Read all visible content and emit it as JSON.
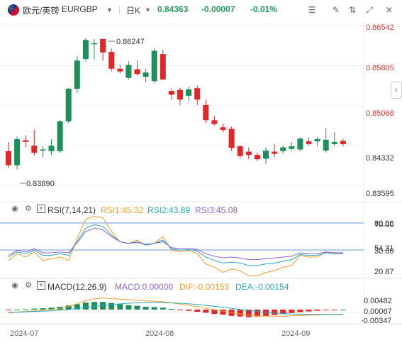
{
  "header": {
    "pair_name": "欧元/英镑",
    "symbol": "EURGBP",
    "interval": "日K",
    "last_price": "0.84363",
    "change": "-0.00007",
    "change_pct": "-0.01%"
  },
  "toolbar": {
    "pencil": "pencil-icon",
    "fullscreen": "fullscreen-icon",
    "close": "close-icon"
  },
  "price_axis": [
    "0.86542",
    "0.85805",
    "0.85068",
    "0.84332",
    "0.83595"
  ],
  "annotations": {
    "high": "0.86247",
    "low": "0.83890"
  },
  "rsi": {
    "title": "RSI(7,14,21)",
    "rsi1": "RSI1:45.32",
    "rsi2": "RSI2:43.89",
    "rsi3": "RSI3:45.08",
    "axis": [
      "80.06",
      "70.00",
      "54.31",
      "30.00",
      "20.87"
    ]
  },
  "macd": {
    "title": "MACD(12,26,9)",
    "macd": "MACD:0.00000",
    "dif": "DIF:-0.00153",
    "dea": "DEA:-0.00154",
    "axis": [
      "0.00482",
      "0.00067",
      "-0.00347"
    ]
  },
  "time_axis": [
    "2024-07",
    "2024-08",
    "2024-09"
  ],
  "colors": {
    "up": "#1e8e5a",
    "down": "#e02626",
    "price_red": "#d23c3c",
    "green_text": "#1e9e5a",
    "rsi1": "#f39c2b",
    "rsi2": "#2aa8b8",
    "rsi3": "#8a63d2",
    "dif": "#f39c2b",
    "dea": "#2aa8b8",
    "ref_line": "#3a78d6"
  },
  "chart_data": [
    {
      "type": "candlestick",
      "title": "",
      "ylim": [
        0.8335,
        0.8665
      ],
      "series": [
        {
          "name": "EURGBP",
          "candles": [
            {
              "o": 0.8423,
              "h": 0.844,
              "l": 0.8392,
              "c": 0.8397
            },
            {
              "o": 0.8397,
              "h": 0.845,
              "l": 0.8389,
              "c": 0.8445
            },
            {
              "o": 0.8443,
              "h": 0.8452,
              "l": 0.843,
              "c": 0.844
            },
            {
              "o": 0.8433,
              "h": 0.8462,
              "l": 0.8415,
              "c": 0.842
            },
            {
              "o": 0.8425,
              "h": 0.8432,
              "l": 0.8412,
              "c": 0.8426
            },
            {
              "o": 0.8423,
              "h": 0.8445,
              "l": 0.8416,
              "c": 0.8433
            },
            {
              "o": 0.8423,
              "h": 0.848,
              "l": 0.842,
              "c": 0.8478
            },
            {
              "o": 0.8478,
              "h": 0.854,
              "l": 0.8475,
              "c": 0.8538
            },
            {
              "o": 0.8538,
              "h": 0.8598,
              "l": 0.853,
              "c": 0.859
            },
            {
              "o": 0.8593,
              "h": 0.8631,
              "l": 0.8588,
              "c": 0.8628
            },
            {
              "o": 0.8622,
              "h": 0.863,
              "l": 0.8592,
              "c": 0.8622
            },
            {
              "o": 0.863,
              "h": 0.8624,
              "l": 0.859,
              "c": 0.8605
            },
            {
              "o": 0.8606,
              "h": 0.8612,
              "l": 0.857,
              "c": 0.8575
            },
            {
              "o": 0.8575,
              "h": 0.8582,
              "l": 0.8566,
              "c": 0.857
            },
            {
              "o": 0.8558,
              "h": 0.8589,
              "l": 0.8555,
              "c": 0.8582
            },
            {
              "o": 0.8574,
              "h": 0.859,
              "l": 0.8563,
              "c": 0.8565
            },
            {
              "o": 0.856,
              "h": 0.8575,
              "l": 0.855,
              "c": 0.8568
            },
            {
              "o": 0.8552,
              "h": 0.8612,
              "l": 0.8548,
              "c": 0.8608
            },
            {
              "o": 0.8602,
              "h": 0.861,
              "l": 0.8554,
              "c": 0.8555
            },
            {
              "o": 0.8534,
              "h": 0.8538,
              "l": 0.8518,
              "c": 0.8527
            },
            {
              "o": 0.8536,
              "h": 0.854,
              "l": 0.8508,
              "c": 0.8518
            },
            {
              "o": 0.8525,
              "h": 0.8542,
              "l": 0.8515,
              "c": 0.8537
            },
            {
              "o": 0.8539,
              "h": 0.8544,
              "l": 0.8508,
              "c": 0.8518
            },
            {
              "o": 0.8508,
              "h": 0.8518,
              "l": 0.8475,
              "c": 0.848
            },
            {
              "o": 0.848,
              "h": 0.8488,
              "l": 0.847,
              "c": 0.8473
            },
            {
              "o": 0.8467,
              "h": 0.8473,
              "l": 0.8458,
              "c": 0.8462
            },
            {
              "o": 0.8464,
              "h": 0.8468,
              "l": 0.8424,
              "c": 0.8429
            },
            {
              "o": 0.8432,
              "h": 0.8434,
              "l": 0.841,
              "c": 0.8414
            },
            {
              "o": 0.8422,
              "h": 0.843,
              "l": 0.8408,
              "c": 0.8416
            },
            {
              "o": 0.8416,
              "h": 0.842,
              "l": 0.8405,
              "c": 0.8408
            },
            {
              "o": 0.8409,
              "h": 0.843,
              "l": 0.84,
              "c": 0.8424
            },
            {
              "o": 0.8422,
              "h": 0.8436,
              "l": 0.8412,
              "c": 0.8418
            },
            {
              "o": 0.8423,
              "h": 0.8434,
              "l": 0.8418,
              "c": 0.843
            },
            {
              "o": 0.8427,
              "h": 0.844,
              "l": 0.8424,
              "c": 0.8432
            },
            {
              "o": 0.8426,
              "h": 0.8448,
              "l": 0.8423,
              "c": 0.8446
            },
            {
              "o": 0.8441,
              "h": 0.8448,
              "l": 0.8434,
              "c": 0.8436
            },
            {
              "o": 0.8441,
              "h": 0.8449,
              "l": 0.8432,
              "c": 0.8445
            },
            {
              "o": 0.8424,
              "h": 0.8465,
              "l": 0.842,
              "c": 0.8444
            },
            {
              "o": 0.8436,
              "h": 0.8458,
              "l": 0.8432,
              "c": 0.844
            },
            {
              "o": 0.8442,
              "h": 0.8446,
              "l": 0.8432,
              "c": 0.8436
            }
          ]
        }
      ]
    },
    {
      "type": "line",
      "title": "RSI(7,14,21)",
      "ylim": [
        15,
        90
      ],
      "series": [
        {
          "name": "RSI1",
          "values": [
            36,
            44,
            40,
            46,
            36,
            38,
            40,
            36,
            62,
            84,
            88,
            86,
            70,
            58,
            56,
            60,
            54,
            56,
            64,
            48,
            46,
            48,
            44,
            32,
            28,
            22,
            26,
            24,
            18,
            18,
            22,
            24,
            28,
            30,
            42,
            40,
            40,
            46,
            44,
            45.3
          ]
        },
        {
          "name": "RSI2",
          "values": [
            40,
            46,
            44,
            48,
            42,
            42,
            44,
            42,
            58,
            74,
            78,
            76,
            66,
            58,
            56,
            58,
            54,
            56,
            60,
            50,
            48,
            49,
            47,
            40,
            36,
            33,
            34,
            33,
            30,
            30,
            32,
            33,
            35,
            37,
            43,
            42,
            42,
            45,
            44,
            43.9
          ]
        },
        {
          "name": "RSI3",
          "values": [
            42,
            48,
            46,
            50,
            45,
            45,
            46,
            45,
            57,
            70,
            74,
            72,
            64,
            58,
            56,
            57,
            55,
            56,
            58,
            51,
            50,
            50,
            49,
            44,
            41,
            39,
            40,
            39,
            37,
            37,
            38,
            39,
            40,
            41,
            45,
            44,
            44,
            46,
            45,
            45.1
          ]
        }
      ]
    },
    {
      "type": "bar",
      "title": "MACD(12,26,9)",
      "ylim": [
        -0.0045,
        0.0058
      ],
      "series": [
        {
          "name": "MACD",
          "values": [
            -0.0002,
            0.0,
            0.0001,
            0.0003,
            0.0004,
            0.0006,
            0.0009,
            0.0013,
            0.0017,
            0.0022,
            0.0024,
            0.0024,
            0.0021,
            0.0017,
            0.0014,
            0.0012,
            0.0009,
            0.0008,
            0.0006,
            0.0002,
            -0.0002,
            -0.0004,
            -0.0007,
            -0.001,
            -0.0014,
            -0.0016,
            -0.002,
            -0.0022,
            -0.0024,
            -0.0022,
            -0.002,
            -0.0017,
            -0.0014,
            -0.0011,
            -0.0008,
            -0.0006,
            -0.0004,
            -0.0002,
            -0.0001,
            0.0
          ]
        },
        {
          "name": "DIF",
          "values": [
            -0.001,
            -0.0008,
            -0.0006,
            -0.0004,
            -0.0002,
            0.0,
            0.0004,
            0.001,
            0.0018,
            0.0028,
            0.0034,
            0.0036,
            0.0035,
            0.0033,
            0.0031,
            0.0029,
            0.0027,
            0.0026,
            0.0025,
            0.0021,
            0.0017,
            0.0013,
            0.0009,
            0.0004,
            -0.0001,
            -0.0005,
            -0.001,
            -0.0014,
            -0.0018,
            -0.002,
            -0.0021,
            -0.0021,
            -0.0021,
            -0.002,
            -0.0019,
            -0.0018,
            -0.0017,
            -0.0016,
            -0.0015,
            -0.00153
          ]
        },
        {
          "name": "DEA",
          "values": [
            -0.0008,
            -0.0008,
            -0.0007,
            -0.0006,
            -0.0005,
            -0.0004,
            -0.0002,
            0.0,
            0.0003,
            0.0007,
            0.001,
            0.0013,
            0.0016,
            0.0018,
            0.002,
            0.0021,
            0.0022,
            0.0022,
            0.0022,
            0.0021,
            0.002,
            0.0018,
            0.0016,
            0.0013,
            0.001,
            0.0007,
            0.0004,
            0.0,
            -0.0003,
            -0.0006,
            -0.0009,
            -0.0011,
            -0.0013,
            -0.0014,
            -0.0015,
            -0.0015,
            -0.0015,
            -0.00155,
            -0.00155,
            -0.00154
          ]
        }
      ]
    }
  ]
}
